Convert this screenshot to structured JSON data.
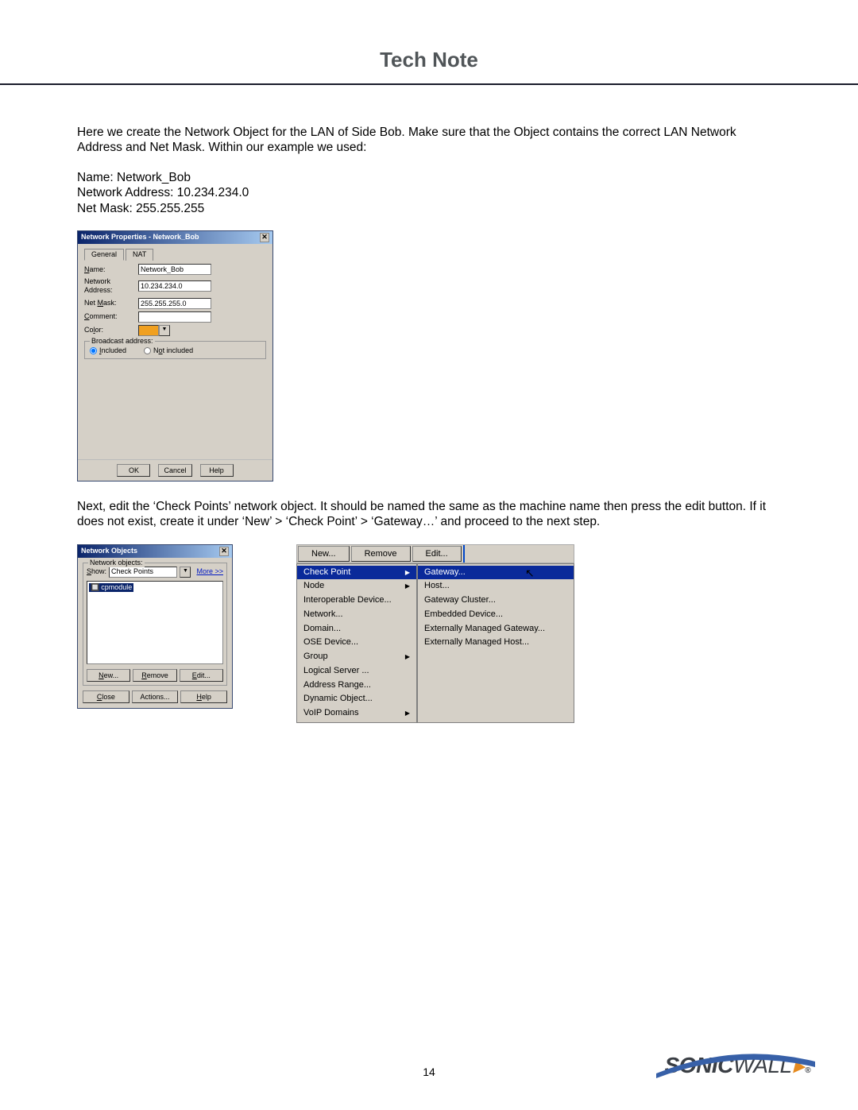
{
  "header": {
    "title": "Tech Note"
  },
  "body": {
    "p1": "Here we create the Network Object for the LAN of Side Bob. Make sure that the Object contains the correct LAN Network Address and Net Mask. Within our example we used:",
    "name_line": "Name: Network_Bob",
    "addr_line": "Network Address: 10.234.234.0",
    "mask_line": "Net Mask: 255.255.255",
    "p2": "Next, edit the ‘Check Points’ network object. It should be named the same as the machine name then press the edit button. If it does not exist, create it under ‘New’ > ‘Check Point’ > ‘Gateway…’ and proceed to the next step."
  },
  "dlg1": {
    "title": "Network Properties - Network_Bob",
    "tab_general": "General",
    "tab_nat": "NAT",
    "lbl_name": "Name:",
    "lbl_addr": "Network Address:",
    "lbl_mask": "Net Mask:",
    "lbl_comment": "Comment:",
    "lbl_color": "Color:",
    "val_name": "Network_Bob",
    "val_addr": "10.234.234.0",
    "val_mask": "255.255.255.0",
    "grp_broadcast": "Broadcast address:",
    "rb_included": "Included",
    "rb_notincluded": "Not included",
    "btn_ok": "OK",
    "btn_cancel": "Cancel",
    "btn_help": "Help"
  },
  "dlg2": {
    "title": "Network Objects",
    "grp": "Network objects:",
    "lbl_show": "Show:",
    "show_val": "Check Points",
    "more": "More >>",
    "item": "cpmodule",
    "btn_new": "New...",
    "btn_remove": "Remove",
    "btn_edit": "Edit...",
    "btn_close": "Close",
    "btn_actions": "Actions...",
    "btn_help": "Help"
  },
  "menu": {
    "btn_new": "New...",
    "btn_remove": "Remove",
    "btn_edit": "Edit...",
    "col1": [
      {
        "label": "Check Point",
        "sub": true,
        "hl": true
      },
      {
        "label": "Node",
        "sub": true
      },
      {
        "label": "Interoperable Device..."
      },
      {
        "label": "Network..."
      },
      {
        "label": "Domain..."
      },
      {
        "label": "OSE Device..."
      },
      {
        "label": "Group",
        "sub": true
      },
      {
        "label": "Logical Server ..."
      },
      {
        "label": "Address Range..."
      },
      {
        "label": "Dynamic Object..."
      },
      {
        "label": "VoIP Domains",
        "sub": true
      }
    ],
    "col2": [
      {
        "label": "Gateway...",
        "hl": true
      },
      {
        "label": "Host..."
      },
      {
        "label": "Gateway Cluster..."
      },
      {
        "label": "Embedded Device..."
      },
      {
        "label": "Externally Managed Gateway..."
      },
      {
        "label": "Externally Managed Host..."
      }
    ]
  },
  "footer": {
    "page": "14",
    "brand1": "SONIC",
    "brand2": "WALL",
    "reg": "®"
  }
}
